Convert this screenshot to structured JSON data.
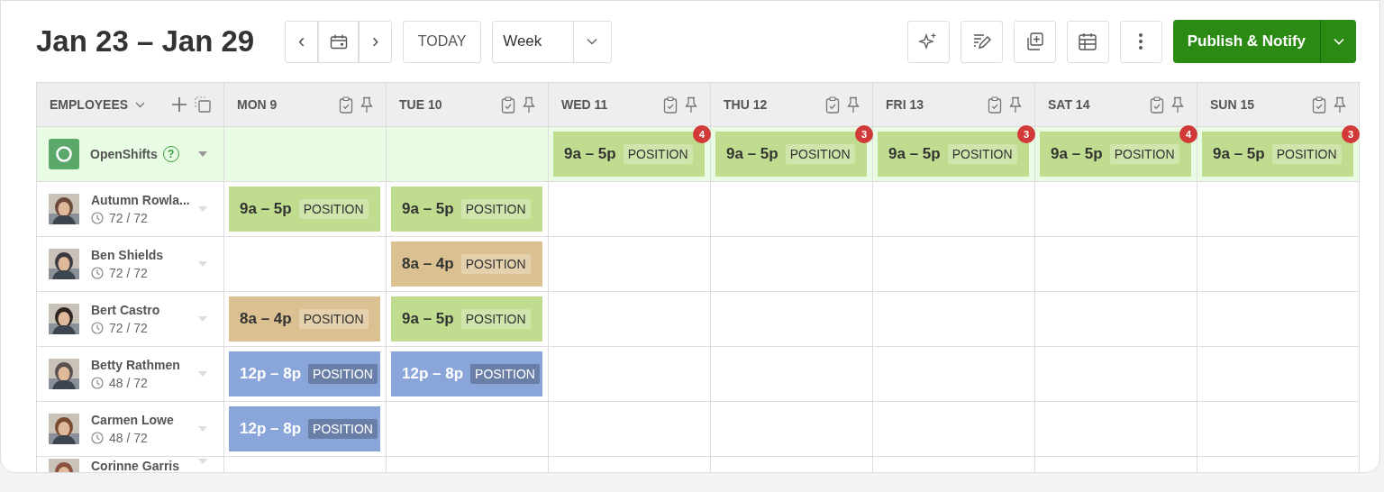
{
  "header": {
    "title": "Jan 23 – Jan 29",
    "prev": "‹",
    "next": "›",
    "today": "TODAY",
    "view": "Week",
    "publish": "Publish & Notify"
  },
  "columns": {
    "employees": "EMPLOYEES",
    "days": [
      "MON 9",
      "TUE 10",
      "WED 11",
      "THU 12",
      "FRI 13",
      "SAT 14",
      "SUN 15"
    ]
  },
  "open_shifts": {
    "label": "OpenShifts",
    "help": "?",
    "cells": [
      {},
      {},
      {
        "time": "9a – 5p",
        "position": "POSITION",
        "color": "#c0dc8f",
        "count": "4"
      },
      {
        "time": "9a – 5p",
        "position": "POSITION",
        "color": "#c0dc8f",
        "count": "3"
      },
      {
        "time": "9a – 5p",
        "position": "POSITION",
        "color": "#c0dc8f",
        "count": "3"
      },
      {
        "time": "9a – 5p",
        "position": "POSITION",
        "color": "#c0dc8f",
        "count": "4"
      },
      {
        "time": "9a – 5p",
        "position": "POSITION",
        "color": "#c0dc8f",
        "count": "3"
      }
    ]
  },
  "employees": [
    {
      "name": "Autumn Rowla...",
      "hours": "72 / 72",
      "cells": [
        {
          "time": "9a – 5p",
          "position": "POSITION",
          "color": "#c0dc8f"
        },
        {
          "time": "9a – 5p",
          "position": "POSITION",
          "color": "#c0dc8f"
        },
        {},
        {},
        {},
        {},
        {}
      ]
    },
    {
      "name": "Ben Shields",
      "hours": "72 / 72",
      "cells": [
        {},
        {
          "time": "8a – 4p",
          "position": "POSITION",
          "color": "#dbc192"
        },
        {},
        {},
        {},
        {},
        {}
      ]
    },
    {
      "name": "Bert Castro",
      "hours": "72 / 72",
      "cells": [
        {
          "time": "8a – 4p",
          "position": "POSITION",
          "color": "#dbc192"
        },
        {
          "time": "9a – 5p",
          "position": "POSITION",
          "color": "#c0dc8f"
        },
        {},
        {},
        {},
        {},
        {}
      ]
    },
    {
      "name": "Betty Rathmen",
      "hours": "48 / 72",
      "cells": [
        {
          "time": "12p – 8p",
          "position": "POSITION",
          "color": "#8aa5d9"
        },
        {
          "time": "12p – 8p",
          "position": "POSITION",
          "color": "#8aa5d9"
        },
        {},
        {},
        {},
        {},
        {}
      ]
    },
    {
      "name": "Carmen Lowe",
      "hours": "48 / 72",
      "cells": [
        {
          "time": "12p – 8p",
          "position": "POSITION",
          "color": "#8aa5d9"
        },
        {},
        {},
        {},
        {},
        {},
        {}
      ]
    },
    {
      "name": "Corinne Garris",
      "cells": [
        {},
        {},
        {},
        {},
        {},
        {},
        {}
      ]
    }
  ]
}
